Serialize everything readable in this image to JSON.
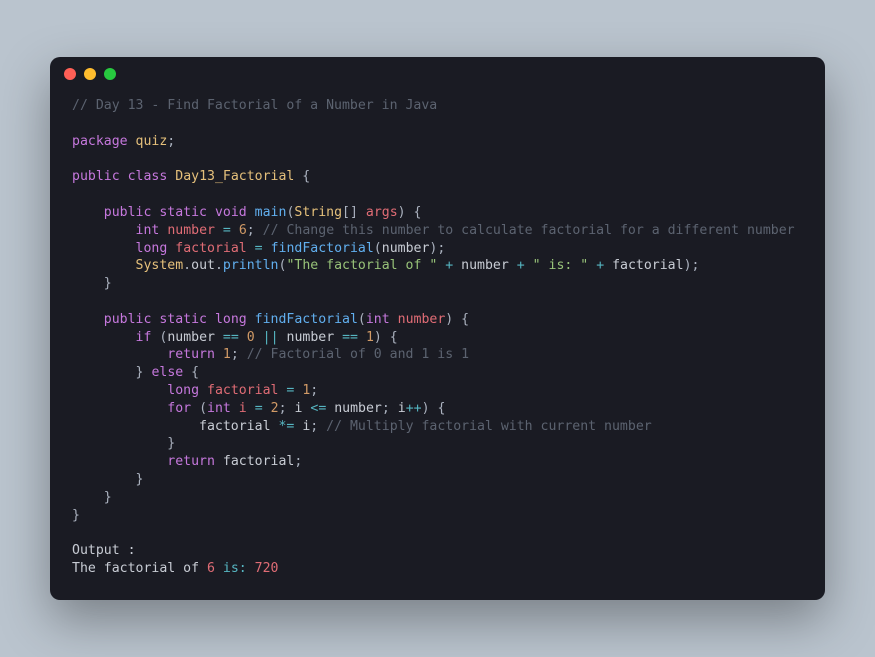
{
  "title_comment": "// Day 13 - Find Factorial of a Number in Java",
  "pkg": {
    "kw": "package",
    "name": "quiz"
  },
  "class_decl": {
    "pub": "public",
    "cls": "class",
    "name": "Day13_Factorial"
  },
  "main": {
    "pub": "public",
    "stat": "static",
    "ret": "void",
    "name": "main",
    "paramType": "String",
    "paramName": "args",
    "l1": {
      "type": "int",
      "var": "number",
      "eq": "=",
      "val": "6",
      "comment": "// Change this number to calculate factorial for a different number"
    },
    "l2": {
      "type": "long",
      "var": "factorial",
      "eq": "=",
      "call": "findFactorial",
      "arg": "number"
    },
    "l3": {
      "obj1": "System",
      "obj2": "out",
      "fn": "println",
      "s1": "\"The factorial of \"",
      "op": "+",
      "v1": "number",
      "s2": "\" is: \"",
      "v2": "factorial"
    }
  },
  "ff": {
    "pub": "public",
    "stat": "static",
    "ret": "long",
    "name": "findFactorial",
    "paramType": "int",
    "paramName": "number",
    "ifkw": "if",
    "cond": {
      "v": "number",
      "eq": "==",
      "z": "0",
      "or": "||",
      "o": "1"
    },
    "r1": {
      "kw": "return",
      "val": "1",
      "comment": "// Factorial of 0 and 1 is 1"
    },
    "elsekw": "else",
    "decl": {
      "type": "long",
      "var": "factorial",
      "eq": "=",
      "val": "1"
    },
    "for": {
      "kw": "for",
      "ty": "int",
      "i": "i",
      "eq": "=",
      "start": "2",
      "le": "<=",
      "lim": "number",
      "inc": "i",
      "pp": "++"
    },
    "body": {
      "lhs": "factorial",
      "op": "*=",
      "rhs": "i",
      "comment": "// Multiply factorial with current number"
    },
    "r2": {
      "kw": "return",
      "val": "factorial"
    }
  },
  "output": {
    "label": "Output :",
    "pre": "The factorial of ",
    "num": "6",
    "mid": " is: ",
    "res": "720"
  }
}
